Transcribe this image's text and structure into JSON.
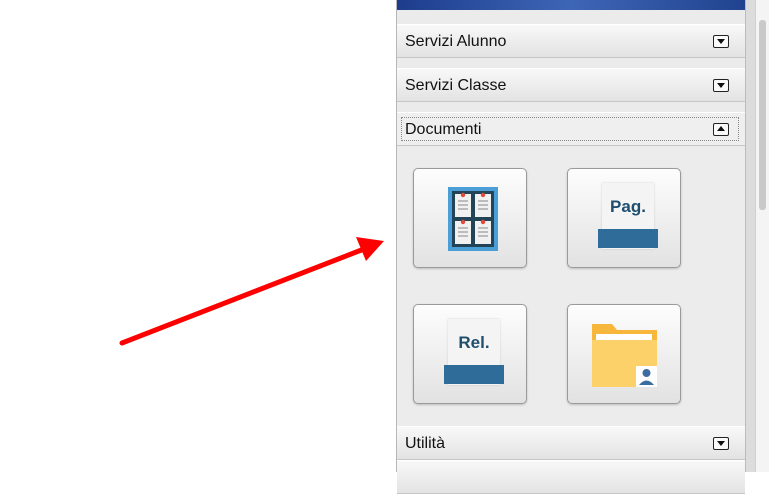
{
  "menu": {
    "sections": [
      {
        "label": "Servizi Alunno",
        "state": "collapsed"
      },
      {
        "label": "Servizi Classe",
        "state": "collapsed"
      },
      {
        "label": "Documenti",
        "state": "expanded"
      },
      {
        "label": "Utilità",
        "state": "collapsed"
      }
    ]
  },
  "documenti": {
    "tiles": [
      {
        "icon": "bulletin-board-icon",
        "text": ""
      },
      {
        "icon": "document-pag-icon",
        "text": "Pag."
      },
      {
        "icon": "document-rel-icon",
        "text": "Rel."
      },
      {
        "icon": "folder-user-icon",
        "text": ""
      }
    ]
  },
  "annotation": {
    "type": "arrow",
    "color": "#ff0000"
  },
  "colors": {
    "accent": "#2f6c99",
    "banner": "#2a4f9e",
    "folder": "#fccd5f"
  }
}
